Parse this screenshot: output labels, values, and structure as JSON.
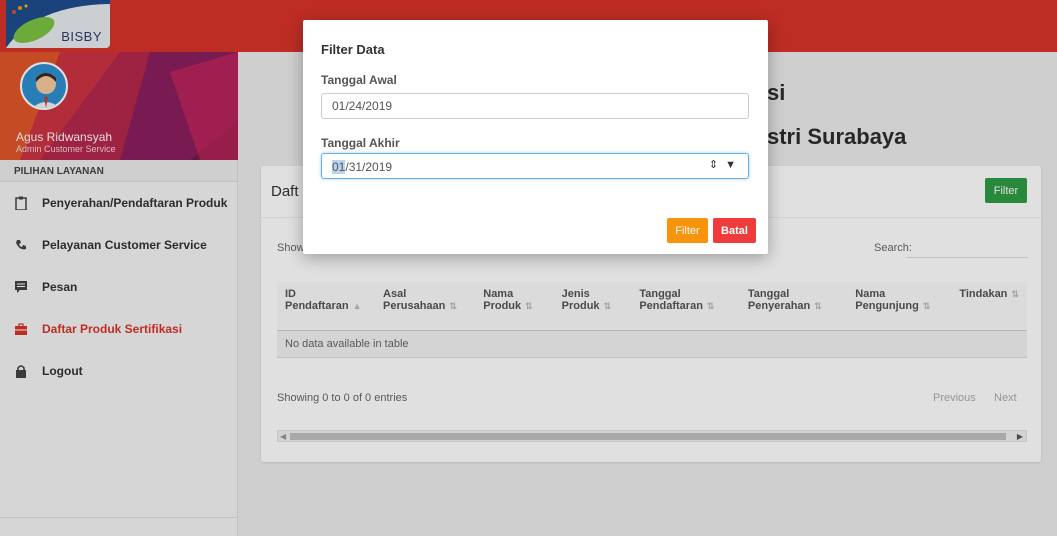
{
  "app": {
    "logo_text": "BISBY"
  },
  "user": {
    "name": "Agus Ridwansyah",
    "role": "Admin Customer Service"
  },
  "sidebar": {
    "section_label": "PILIHAN LAYANAN",
    "items": [
      {
        "label": "Penyerahan/Pendaftaran Produk",
        "icon": "clipboard-icon",
        "active": false
      },
      {
        "label": "Pelayanan Customer Service",
        "icon": "phone-icon",
        "active": false
      },
      {
        "label": "Pesan",
        "icon": "message-icon",
        "active": false
      },
      {
        "label": "Daftar Produk Sertifikasi",
        "icon": "briefcase-icon",
        "active": true
      },
      {
        "label": "Logout",
        "icon": "lock-icon",
        "active": false
      }
    ]
  },
  "main": {
    "title_line1": "si",
    "title_line2": "stri Surabaya",
    "card_title": "Daft",
    "filter_button": "Filter",
    "show_label": "Show",
    "search_label": "Search:",
    "table": {
      "columns": [
        "ID Pendaftaran",
        "Asal Perusahaan",
        "Nama Produk",
        "Jenis Produk",
        "Tanggal Pendaftaran",
        "Tanggal Penyerahan",
        "Nama Pengunjung",
        "Tindakan"
      ],
      "empty_message": "No data available in table"
    },
    "info": "Showing 0 to 0 of 0 entries",
    "pagination": {
      "previous": "Previous",
      "next": "Next"
    }
  },
  "modal": {
    "title": "Filter Data",
    "start_label": "Tanggal Awal",
    "start_value": "01/24/2019",
    "end_label": "Tanggal Akhir",
    "end_value_month": "01",
    "end_value_rest": "/31/2019",
    "filter_button": "Filter",
    "cancel_button": "Batal"
  },
  "colors": {
    "topbar": "#d8342a",
    "filter_green": "#2e9d45",
    "filter_orange": "#f7930d",
    "cancel_red": "#ef3b3b",
    "active_menu": "#d8342a"
  }
}
